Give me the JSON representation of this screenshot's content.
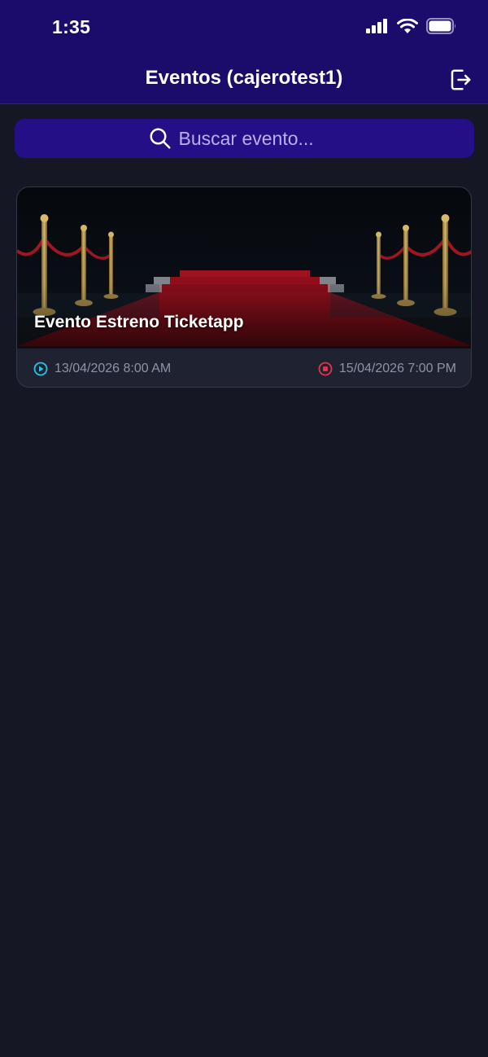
{
  "status_bar": {
    "time": "1:35"
  },
  "header": {
    "title": "Eventos (cajerotest1)",
    "logout_icon": "logout-icon"
  },
  "search": {
    "placeholder": "Buscar evento...",
    "icon": "search-icon"
  },
  "events": [
    {
      "title": "Evento Estreno Ticketapp",
      "start": "13/04/2026 8:00 AM",
      "end": "15/04/2026 7:00 PM",
      "start_icon": "play-circle-icon",
      "end_icon": "stop-circle-icon"
    }
  ],
  "colors": {
    "header_bg": "#1b0b6b",
    "search_bg": "#250f86",
    "page_bg": "#151724",
    "start_accent": "#27c4e6",
    "end_accent": "#e0344e"
  }
}
